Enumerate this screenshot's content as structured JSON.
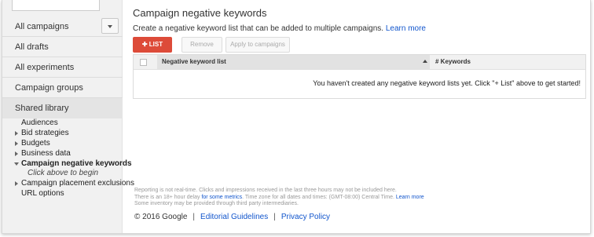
{
  "sidebar": {
    "nav": [
      {
        "label": "All campaigns"
      },
      {
        "label": "All drafts"
      },
      {
        "label": "All experiments"
      },
      {
        "label": "Campaign groups"
      },
      {
        "label": "Shared library"
      }
    ],
    "tree": [
      {
        "label": "Audiences",
        "expander": "none"
      },
      {
        "label": "Bid strategies",
        "expander": "collapsed"
      },
      {
        "label": "Budgets",
        "expander": "collapsed"
      },
      {
        "label": "Business data",
        "expander": "collapsed"
      },
      {
        "label": "Campaign negative keywords",
        "expander": "expanded",
        "hint": "Click above to begin"
      },
      {
        "label": "Campaign placement exclusions",
        "expander": "collapsed"
      },
      {
        "label": "URL options",
        "expander": "none"
      }
    ]
  },
  "main": {
    "title": "Campaign negative keywords",
    "description": "Create a negative keyword list that can be added to multiple campaigns.",
    "learn_more": "Learn more",
    "buttons": {
      "list": "LIST",
      "remove": "Remove",
      "apply": "Apply to campaigns"
    },
    "table": {
      "col_name": "Negative keyword list",
      "col_keywords": "# Keywords",
      "empty": "You haven't created any negative keyword lists yet. Click \"+ List\" above to get started!"
    }
  },
  "footnote": {
    "line1": "Reporting is not real-time. Clicks and impressions received in the last three hours may not be included here.",
    "line2_pre": "There is an 18+ hour delay",
    "line2_link": "for some metrics",
    "line2_post": ". Time zone for all dates and times: (GMT-08:00) Central Time.",
    "line2_learn": "Learn more",
    "line3": "Some inventory may be provided through third party intermediaries."
  },
  "footer": {
    "copyright": "© 2016 Google",
    "separator": "|",
    "guidelines": "Editorial Guidelines",
    "privacy": "Privacy Policy"
  },
  "colors": {
    "accent_red": "#dd4b39",
    "link_blue": "#1155cc",
    "sidebar_bg": "#f1f1f1"
  }
}
